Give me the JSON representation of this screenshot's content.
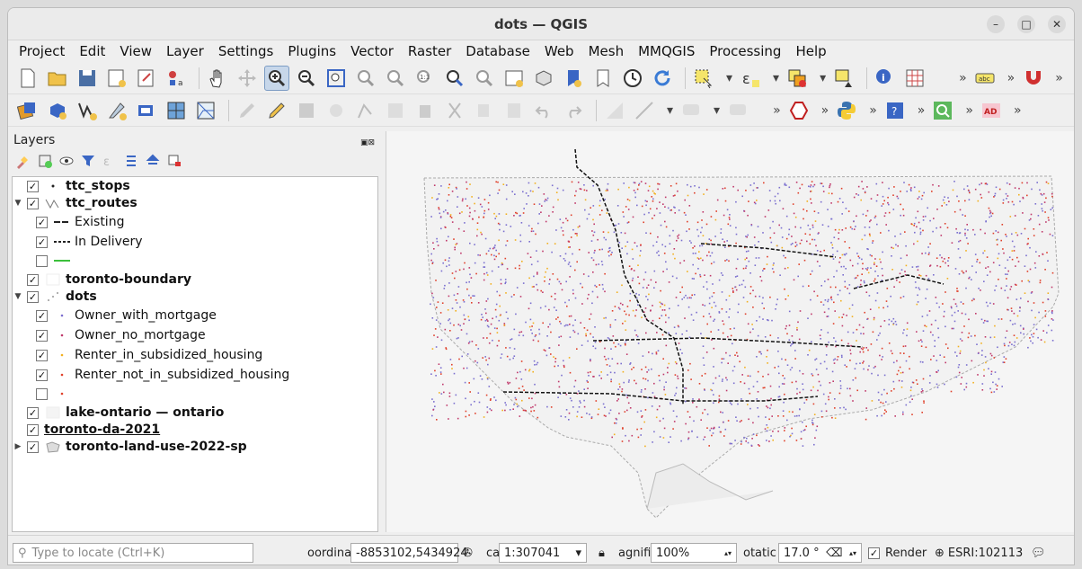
{
  "window": {
    "title": "dots — QGIS"
  },
  "menu": [
    "Project",
    "Edit",
    "View",
    "Layer",
    "Settings",
    "Plugins",
    "Vector",
    "Raster",
    "Database",
    "Web",
    "Mesh",
    "MMQGIS",
    "Processing",
    "Help"
  ],
  "panel": {
    "title": "Layers"
  },
  "layers": [
    {
      "id": "ttc_stops",
      "label": "ttc_stops",
      "checked": true,
      "bold": true
    },
    {
      "id": "ttc_routes",
      "label": "ttc_routes",
      "checked": true,
      "bold": true,
      "expanded": true
    },
    {
      "id": "existing",
      "label": "Existing",
      "checked": true
    },
    {
      "id": "in_delivery",
      "label": "In Delivery",
      "checked": true
    },
    {
      "id": "green_line",
      "label": "",
      "checked": false
    },
    {
      "id": "toronto_boundary",
      "label": "toronto-boundary",
      "checked": true,
      "bold": true
    },
    {
      "id": "dots",
      "label": "dots",
      "checked": true,
      "bold": true,
      "expanded": true
    },
    {
      "id": "owner_with_mortgage",
      "label": "Owner_with_mortgage",
      "checked": true,
      "color": "#7b6fcf"
    },
    {
      "id": "owner_no_mortgage",
      "label": "Owner_no_mortgage",
      "checked": true,
      "color": "#c0396b"
    },
    {
      "id": "renter_subsidized",
      "label": "Renter_in_subsidized_housing",
      "checked": true,
      "color": "#f2b01e"
    },
    {
      "id": "renter_not_subsidized",
      "label": "Renter_not_in_subsidized_housing",
      "checked": true,
      "color": "#e0402a"
    },
    {
      "id": "dots_other",
      "label": "",
      "checked": false,
      "color": "#e0402a"
    },
    {
      "id": "lake_ontario",
      "label": "lake-ontario — ontario",
      "checked": true,
      "bold": true
    },
    {
      "id": "toronto_da",
      "label": "toronto-da-2021",
      "checked": true,
      "bold": true,
      "underline": true
    },
    {
      "id": "land_use",
      "label": "toronto-land-use-2022-sp",
      "checked": true,
      "bold": true,
      "collapsed": true
    }
  ],
  "status": {
    "locate_placeholder": "Type to locate (Ctrl+K)",
    "coordinate_label": "oordinat",
    "coordinate_value": "-8853102,5434924",
    "scale_label": "cal",
    "scale_value": "1:307041",
    "magnifier_label": "agnifi",
    "magnifier_value": "100%",
    "rotation_label": "otatic",
    "rotation_value": "17.0 °",
    "render_label": "Render",
    "crs": "ESRI:102113"
  },
  "colors": {
    "owner_with_mortgage": "#7b6fcf",
    "owner_no_mortgage": "#c0396b",
    "renter_subsidized": "#f2b01e",
    "renter_not_subsidized": "#e0402a"
  }
}
